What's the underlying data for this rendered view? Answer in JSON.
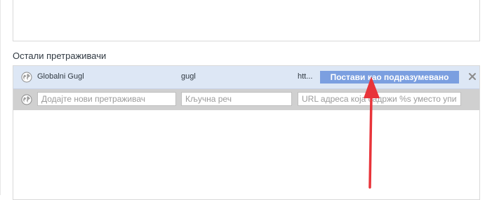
{
  "section": {
    "title": "Остали претраживачи"
  },
  "engine": {
    "icon": "globe-icon",
    "name": "Globalni Gugl",
    "keyword": "gugl",
    "url": "htt...",
    "make_default_label": "Постави као подразумевано",
    "remove_icon": "close-icon"
  },
  "add_engine": {
    "icon": "globe-icon",
    "name_placeholder": "Додајте нови претраживач",
    "keyword_placeholder": "Кључна реч",
    "url_placeholder": "URL адреса која садржи %s уместо упита"
  },
  "colors": {
    "selected_row": "#dde7f5",
    "input_row": "#d0d0d0",
    "button": "#7b9fe0",
    "arrow": "#e8343a"
  }
}
